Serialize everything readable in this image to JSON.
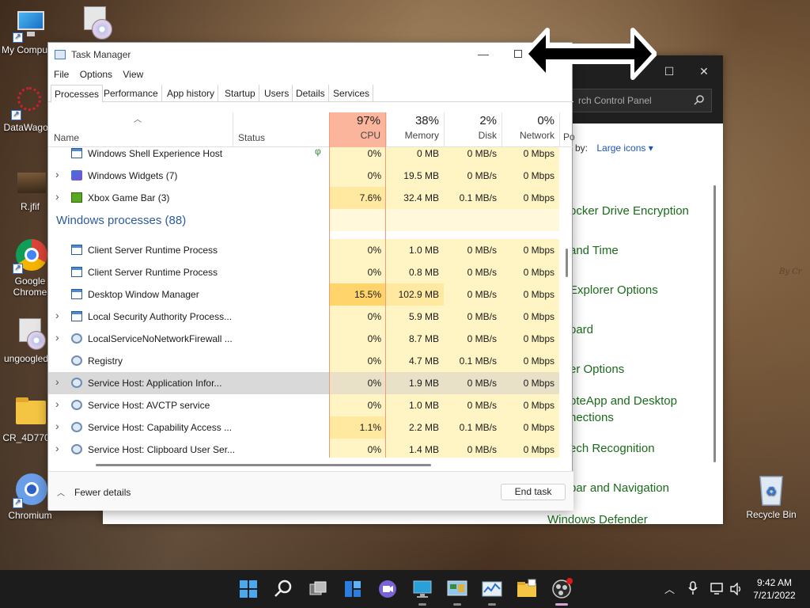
{
  "desktop": {
    "icons": [
      {
        "label": "My Computer"
      },
      {
        "label": "DataWagon"
      },
      {
        "label": "R.jfif"
      },
      {
        "label": "Google Chrome"
      },
      {
        "label": "ungoogled..."
      },
      {
        "label": "CR_4D770..."
      },
      {
        "label": "Chromium"
      }
    ],
    "recycle_bin": "Recycle Bin"
  },
  "control_panel": {
    "search_placeholder": "rch Control Panel",
    "view_by_label": "by:",
    "view_by_value": "Large icons",
    "items": [
      "ocker Drive Encryption",
      "and Time",
      "Explorer Options",
      "oard",
      "er Options",
      "oteApp and Desktop",
      "nections",
      "ech Recognition",
      "bar and Navigation",
      "Windows Defender"
    ]
  },
  "task_manager": {
    "title": "Task Manager",
    "menu": [
      "File",
      "Options",
      "View"
    ],
    "tabs": [
      "Processes",
      "Performance",
      "App history",
      "Startup",
      "Users",
      "Details",
      "Services"
    ],
    "active_tab": "Processes",
    "columns": {
      "name": "Name",
      "status": "Status",
      "cpu": {
        "pct": "97%",
        "label": "CPU"
      },
      "memory": {
        "pct": "38%",
        "label": "Memory"
      },
      "disk": {
        "pct": "2%",
        "label": "Disk"
      },
      "network": {
        "pct": "0%",
        "label": "Network"
      },
      "power": "Po"
    },
    "rows": [
      {
        "name": "Windows Shell Experience Host",
        "cpu": "0%",
        "mem": "0 MB",
        "disk": "0 MB/s",
        "net": "0 Mbps",
        "icon": "window-icon"
      },
      {
        "name": "Windows Widgets (7)",
        "cpu": "0%",
        "mem": "19.5 MB",
        "disk": "0 MB/s",
        "net": "0 Mbps",
        "icon": "widgets-icon"
      },
      {
        "name": "Xbox Game Bar (3)",
        "cpu": "7.6%",
        "mem": "32.4 MB",
        "disk": "0.1 MB/s",
        "net": "0 Mbps",
        "icon": "xbox-icon"
      },
      {
        "group": "Windows processes (88)"
      },
      {
        "name": "Client Server Runtime Process",
        "cpu": "0%",
        "mem": "1.0 MB",
        "disk": "0 MB/s",
        "net": "0 Mbps",
        "icon": "window-icon"
      },
      {
        "name": "Client Server Runtime Process",
        "cpu": "0%",
        "mem": "0.8 MB",
        "disk": "0 MB/s",
        "net": "0 Mbps",
        "icon": "window-icon"
      },
      {
        "name": "Desktop Window Manager",
        "cpu": "15.5%",
        "mem": "102.9 MB",
        "disk": "0 MB/s",
        "net": "0 Mbps",
        "icon": "window-icon"
      },
      {
        "name": "Local Security Authority Process...",
        "cpu": "0%",
        "mem": "5.9 MB",
        "disk": "0 MB/s",
        "net": "0 Mbps",
        "icon": "window-icon"
      },
      {
        "name": "LocalServiceNoNetworkFirewall ...",
        "cpu": "0%",
        "mem": "8.7 MB",
        "disk": "0 MB/s",
        "net": "0 Mbps",
        "icon": "gear-icon"
      },
      {
        "name": "Registry",
        "cpu": "0%",
        "mem": "4.7 MB",
        "disk": "0.1 MB/s",
        "net": "0 Mbps",
        "icon": "gear-icon"
      },
      {
        "name": "Service Host: Application Infor...",
        "cpu": "0%",
        "mem": "1.9 MB",
        "disk": "0 MB/s",
        "net": "0 Mbps",
        "icon": "gear-icon"
      },
      {
        "name": "Service Host: AVCTP service",
        "cpu": "0%",
        "mem": "1.0 MB",
        "disk": "0 MB/s",
        "net": "0 Mbps",
        "icon": "gear-icon"
      },
      {
        "name": "Service Host: Capability Access ...",
        "cpu": "1.1%",
        "mem": "2.2 MB",
        "disk": "0.1 MB/s",
        "net": "0 Mbps",
        "icon": "gear-icon"
      },
      {
        "name": "Service Host: Clipboard User Ser...",
        "cpu": "0%",
        "mem": "1.4 MB",
        "disk": "0 MB/s",
        "net": "0 Mbps",
        "icon": "gear-icon"
      }
    ],
    "fewer_details": "Fewer details",
    "end_task": "End task"
  },
  "taskbar": {
    "clock_time": "9:42 AM",
    "clock_date": "7/21/2022"
  },
  "colors": {
    "cpu_header": "#fbb59c",
    "cell_light": "#fff4c4",
    "cell_medium": "#ffe9a0",
    "cell_hot": "#ffd56b",
    "taskbar": "#1c1c1c"
  }
}
